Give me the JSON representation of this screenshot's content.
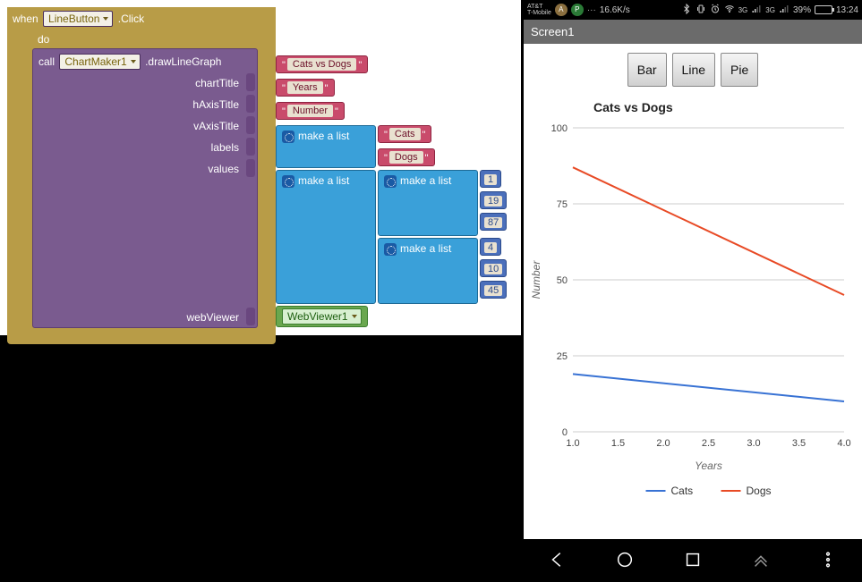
{
  "blocks": {
    "when": {
      "prefix": "when",
      "component": "LineButton",
      "suffix": ".Click"
    },
    "do_label": "do",
    "call": {
      "prefix": "call",
      "component": "ChartMaker1",
      "suffix": ".drawLineGraph"
    },
    "args": {
      "chartTitle": {
        "label": "chartTitle",
        "value": "Cats vs Dogs"
      },
      "hAxisTitle": {
        "label": "hAxisTitle",
        "value": "Years"
      },
      "vAxisTitle": {
        "label": "vAxisTitle",
        "value": "Number"
      },
      "labels": {
        "label": "labels",
        "make_list": "make a list",
        "items": [
          "Cats",
          "Dogs"
        ]
      },
      "values": {
        "label": "values",
        "make_list": "make a list",
        "inner_make_list": "make a list",
        "series1": [
          "1",
          "19",
          "87"
        ],
        "series2": [
          "4",
          "10",
          "45"
        ]
      },
      "webViewer": {
        "label": "webViewer",
        "value": "WebViewer1"
      }
    }
  },
  "phone": {
    "status": {
      "carrier": "AT&T",
      "carrier2": "T-Mobile",
      "speed": "16.6K/s",
      "net3g": "3G",
      "battery_pct": "39%",
      "time": "13:24"
    },
    "screen_title": "Screen1",
    "tabs": {
      "bar": "Bar",
      "line": "Line",
      "pie": "Pie"
    },
    "chart": {
      "title": "Cats vs Dogs",
      "xlabel": "Years",
      "ylabel": "Number",
      "yticks": [
        "0",
        "25",
        "50",
        "75",
        "100"
      ],
      "xticks": [
        "1.0",
        "1.5",
        "2.0",
        "2.5",
        "3.0",
        "3.5",
        "4.0"
      ],
      "legend": {
        "cats": "Cats",
        "dogs": "Dogs"
      }
    }
  },
  "chart_data": {
    "type": "line",
    "title": "Cats vs Dogs",
    "xlabel": "Years",
    "ylabel": "Number",
    "x": [
      1.0,
      4.0
    ],
    "series": [
      {
        "name": "Cats",
        "values": [
          19,
          10
        ],
        "color": "#3872d4"
      },
      {
        "name": "Dogs",
        "values": [
          87,
          45
        ],
        "color": "#e84a25"
      }
    ],
    "ylim": [
      0,
      100
    ],
    "xlim": [
      1.0,
      4.0
    ],
    "yticks": [
      0,
      25,
      50,
      75,
      100
    ],
    "xticks": [
      1.0,
      1.5,
      2.0,
      2.5,
      3.0,
      3.5,
      4.0
    ],
    "legend_position": "bottom",
    "grid": true
  }
}
